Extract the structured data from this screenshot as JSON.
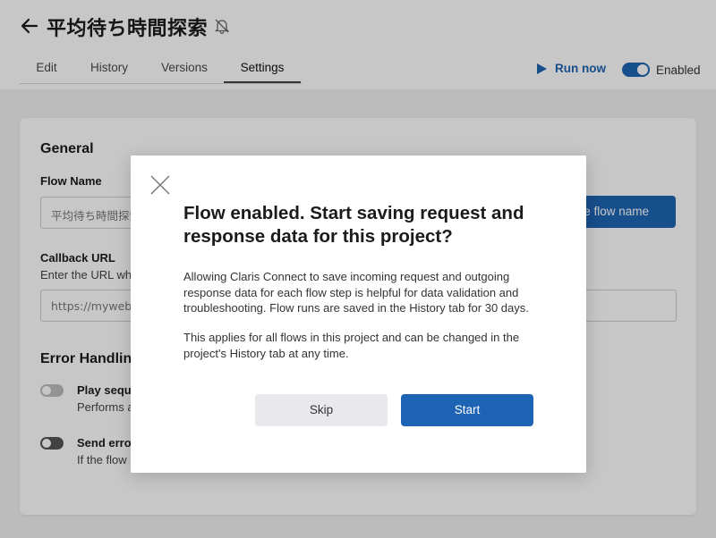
{
  "header": {
    "title": "平均待ち時間探索",
    "back_icon": "arrow-left-icon",
    "notification_icon": "bell-off-icon",
    "tabs": [
      {
        "label": "Edit"
      },
      {
        "label": "History"
      },
      {
        "label": "Versions"
      },
      {
        "label": "Settings",
        "active": true
      }
    ],
    "run_now_label": "Run now",
    "enabled_label": "Enabled",
    "enabled": true
  },
  "settings": {
    "general_title": "General",
    "flow_name_label": "Flow Name",
    "flow_name_value": "平均待ち時間探索",
    "save_flow_name_label": "Save flow name",
    "callback_url_label": "Callback URL",
    "callback_url_help": "Enter the URL where",
    "callback_url_placeholder": "https://mywebhook",
    "error_handling_title": "Error Handling",
    "options": [
      {
        "title": "Play sequentially",
        "desc": "Performs a",
        "enabled": false
      },
      {
        "title": "Send error",
        "desc": "If the flow",
        "enabled": false
      }
    ]
  },
  "modal": {
    "close_icon": "close-icon",
    "title": "Flow enabled. Start saving request and response data for this project?",
    "paragraph1": "Allowing Claris Connect to save incoming request and outgoing response data for each flow step is helpful for data validation and troubleshooting. Flow runs are saved in the History tab for 30 days.",
    "paragraph2": "This applies for all flows in this project and can be changed in the project's History tab at any time.",
    "skip_label": "Skip",
    "start_label": "Start"
  },
  "colors": {
    "accent": "#1e64b4",
    "overlay": "rgba(0,0,0,0.22)",
    "page_bg": "#f1f1f1"
  }
}
